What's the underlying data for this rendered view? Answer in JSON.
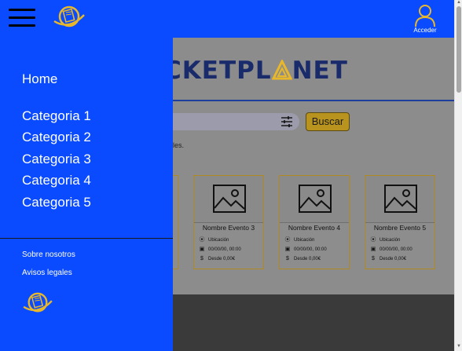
{
  "header": {
    "acceder_label": "Acceder"
  },
  "colors": {
    "primary_blue": "#0a4bff",
    "accent_gold": "#e8b82a",
    "brand_navy": "#1a2b6b"
  },
  "icons": {
    "menu": "hamburger-menu-icon",
    "logo": "planet-ticket-logo-icon",
    "user": "user-icon",
    "filter": "filter-sliders-icon",
    "image": "image-placeholder-icon",
    "location": "location-pin-icon",
    "calendar": "calendar-icon",
    "price": "dollar-icon"
  },
  "brand": {
    "title_part1": "CKETPL",
    "title_part2": "NET"
  },
  "search": {
    "button_label": "Buscar",
    "hint_text": "les."
  },
  "events": [
    {
      "title": "Nombre Evento 3",
      "location": "Ubicación",
      "datetime": "00/00/00, 00:00",
      "price": "Desde 0,00€"
    },
    {
      "title": "Nombre Evento 4",
      "location": "Ubicación",
      "datetime": "00/00/00, 00:00",
      "price": "Desde 0,00€"
    },
    {
      "title": "Nombre Evento 5",
      "location": "Ubicación",
      "datetime": "00/00/00, 00:00",
      "price": "Desde 0,00€"
    }
  ],
  "drawer": {
    "home_label": "Home",
    "categories": [
      "Categoria 1",
      "Categoria 2",
      "Categoria 3",
      "Categoria 4",
      "Categoria 5"
    ],
    "footer_links": [
      "Sobre nosotros",
      "Avisos legales"
    ]
  }
}
